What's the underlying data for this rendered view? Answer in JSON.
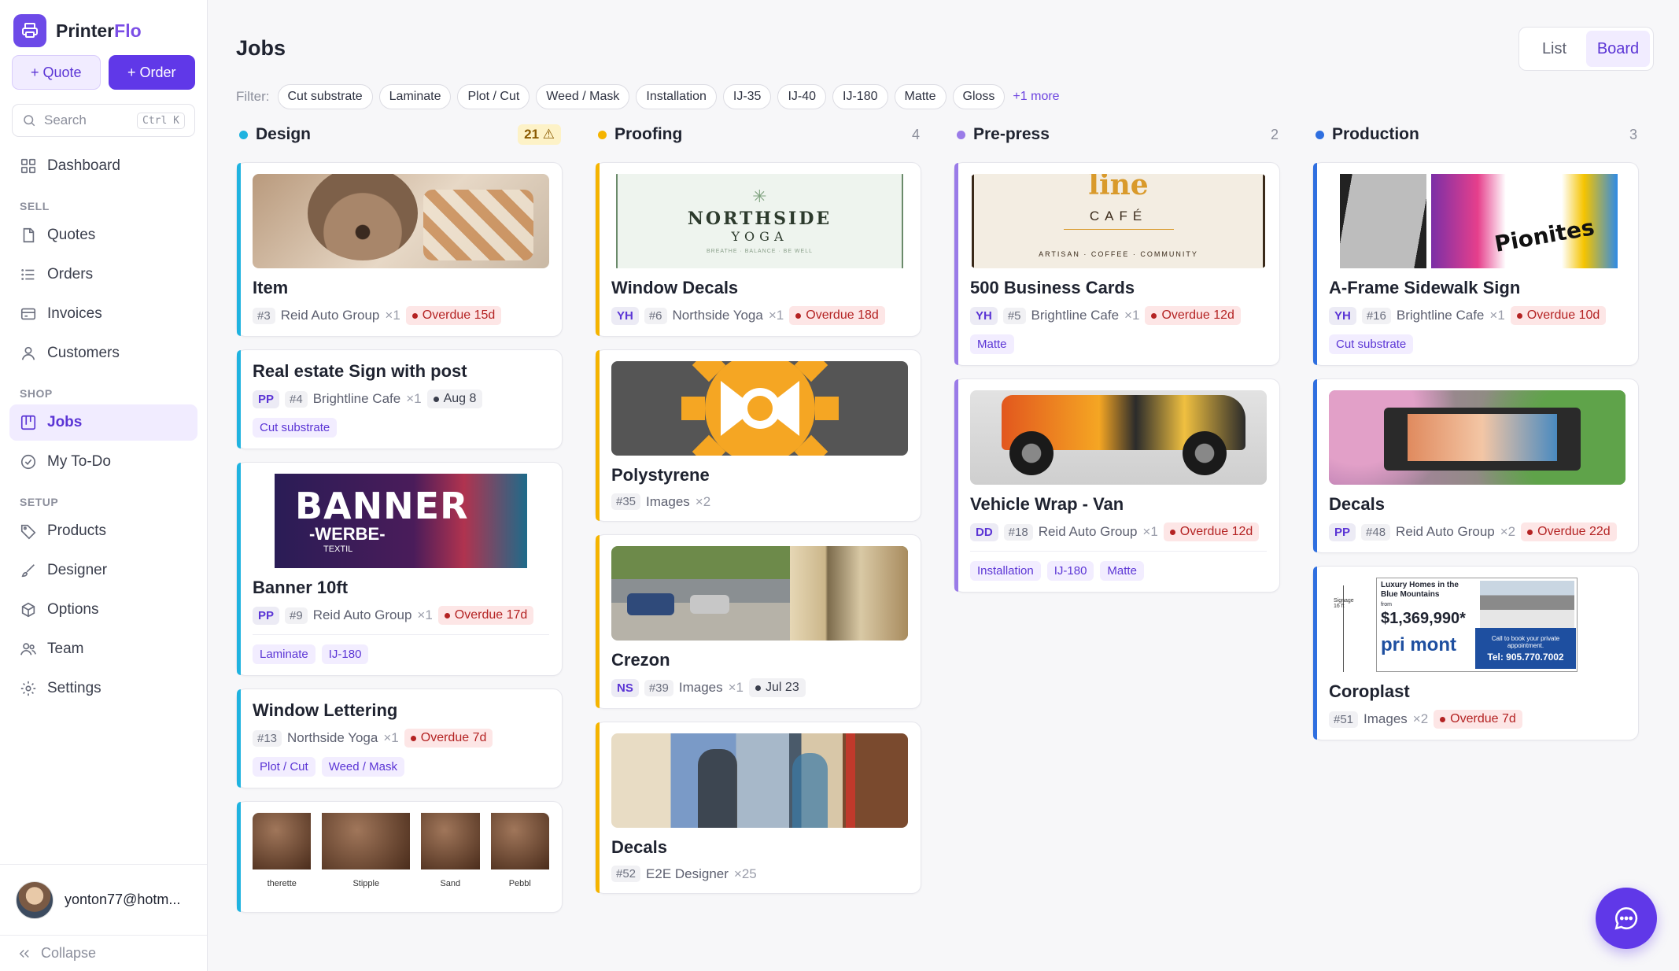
{
  "brand": {
    "name_a": "Printer",
    "name_b": "Flo"
  },
  "actions": {
    "quote": "+ Quote",
    "order": "+ Order"
  },
  "search": {
    "placeholder": "Search",
    "shortcut": "Ctrl K"
  },
  "nav": {
    "dashboard": "Dashboard",
    "sell": "SELL",
    "quotes": "Quotes",
    "orders": "Orders",
    "invoices": "Invoices",
    "customers": "Customers",
    "shop": "SHOP",
    "jobs": "Jobs",
    "todo": "My To-Do",
    "setup": "SETUP",
    "products": "Products",
    "designer": "Designer",
    "options": "Options",
    "team": "Team",
    "settings": "Settings"
  },
  "user": {
    "email": "yonton77@hotm..."
  },
  "collapse": "Collapse",
  "page": {
    "title": "Jobs"
  },
  "view": {
    "list": "List",
    "board": "Board",
    "active": "Board"
  },
  "filter": {
    "label": "Filter:",
    "chips": [
      "Cut substrate",
      "Laminate",
      "Plot / Cut",
      "Weed / Mask",
      "Installation",
      "IJ-35",
      "IJ-40",
      "IJ-180",
      "Matte",
      "Gloss"
    ],
    "more": "+1 more"
  },
  "columns": [
    {
      "title": "Design",
      "count": "21 ⚠",
      "color": "#1fb3e0",
      "warn": true,
      "cards": [
        {
          "thumb": "dog",
          "title": "Item",
          "initials": "",
          "num": "#3",
          "customer": "Reid Auto Group",
          "qty": "×1",
          "due": "Overdue 15d",
          "overdue": true,
          "tags": [],
          "divider": false
        },
        {
          "thumb": "",
          "title": "Real estate Sign with post",
          "initials": "PP",
          "num": "#4",
          "customer": "Brightline Cafe",
          "qty": "×1",
          "due": "Aug 8",
          "overdue": false,
          "tags": [
            "Cut substrate"
          ],
          "divider": false
        },
        {
          "thumb": "banner",
          "title": "Banner 10ft",
          "initials": "PP",
          "num": "#9",
          "customer": "Reid Auto Group",
          "qty": "×1",
          "due": "Overdue 17d",
          "overdue": true,
          "tags": [
            "Laminate",
            "IJ-180"
          ],
          "divider": true
        },
        {
          "thumb": "",
          "title": "Window Lettering",
          "initials": "",
          "num": "#13",
          "customer": "Northside Yoga",
          "qty": "×1",
          "due": "Overdue 7d",
          "overdue": true,
          "tags": [
            "Plot / Cut",
            "Weed / Mask"
          ],
          "divider": false
        },
        {
          "thumb": "leather",
          "title": "",
          "initials": "",
          "num": "",
          "customer": "",
          "qty": "",
          "due": "",
          "overdue": false,
          "tags": [],
          "divider": false
        }
      ]
    },
    {
      "title": "Proofing",
      "count": "4",
      "color": "#f5b400",
      "warn": false,
      "cards": [
        {
          "thumb": "yoga",
          "title": "Window Decals",
          "initials": "YH",
          "num": "#6",
          "customer": "Northside Yoga",
          "qty": "×1",
          "due": "Overdue 18d",
          "overdue": true,
          "tags": [],
          "divider": false
        },
        {
          "thumb": "gear",
          "title": "Polystyrene",
          "initials": "",
          "num": "#35",
          "customer": "Images",
          "qty": "×2",
          "due": "",
          "overdue": false,
          "tags": [],
          "divider": false
        },
        {
          "thumb": "street",
          "title": "Crezon",
          "initials": "NS",
          "num": "#39",
          "customer": "Images",
          "qty": "×1",
          "due": "Jul 23",
          "overdue": false,
          "tags": [],
          "divider": false
        },
        {
          "thumb": "window",
          "title": "Decals",
          "initials": "",
          "num": "#52",
          "customer": "E2E Designer",
          "qty": "×25",
          "due": "",
          "overdue": false,
          "tags": [],
          "divider": false
        }
      ]
    },
    {
      "title": "Pre-press",
      "count": "2",
      "color": "#9a7be8",
      "warn": false,
      "cards": [
        {
          "thumb": "cafe",
          "title": "500 Business Cards",
          "initials": "YH",
          "num": "#5",
          "customer": "Brightline Cafe",
          "qty": "×1",
          "due": "Overdue 12d",
          "overdue": true,
          "tags": [
            "Matte"
          ],
          "divider": false
        },
        {
          "thumb": "truck",
          "title": "Vehicle Wrap - Van",
          "initials": "DD",
          "num": "#18",
          "customer": "Reid Auto Group",
          "qty": "×1",
          "due": "Overdue 12d",
          "overdue": true,
          "tags": [
            "Installation",
            "IJ-180",
            "Matte"
          ],
          "divider": true
        }
      ]
    },
    {
      "title": "Production",
      "count": "3",
      "color": "#2f6fe0",
      "warn": false,
      "cards": [
        {
          "thumb": "aframe",
          "title": "A-Frame Sidewalk Sign",
          "initials": "YH",
          "num": "#16",
          "customer": "Brightline Cafe",
          "qty": "×1",
          "due": "Overdue 10d",
          "overdue": true,
          "tags": [
            "Cut substrate"
          ],
          "divider": false
        },
        {
          "thumb": "printer",
          "title": "Decals",
          "initials": "PP",
          "num": "#48",
          "customer": "Reid Auto Group",
          "qty": "×2",
          "due": "Overdue 22d",
          "overdue": true,
          "tags": [],
          "divider": false
        },
        {
          "thumb": "realty",
          "title": "Coroplast",
          "initials": "",
          "num": "#51",
          "customer": "Images",
          "qty": "×2",
          "due": "Overdue 7d",
          "overdue": true,
          "tags": [],
          "divider": false
        }
      ]
    }
  ],
  "thumb_text": {
    "banner": {
      "l1": "BANNER",
      "l2": "-WERBE-",
      "l3": "TEXTIL"
    },
    "yoga": {
      "l1": "NORTHSIDE",
      "l2": "YOGA",
      "l3": "BREATHE · BALANCE · BE WELL"
    },
    "cafe": {
      "l1": "line",
      "l2": "CAFÉ",
      "l3": "ARTISAN · COFFEE · COMMUNITY"
    },
    "aframe": {
      "l1": "Pionites"
    },
    "realty": {
      "l1": "Luxury Homes in the Blue Mountains",
      "l2": "from",
      "l3": "$1,369,990*",
      "l4": "pri mont",
      "l5": "Call to book your private appointment.",
      "l6": "Tel: 905.770.7002",
      "l7": "Signage 16 ft"
    },
    "leather": [
      "therette",
      "Stipple",
      "Sand",
      "Pebbl"
    ]
  }
}
